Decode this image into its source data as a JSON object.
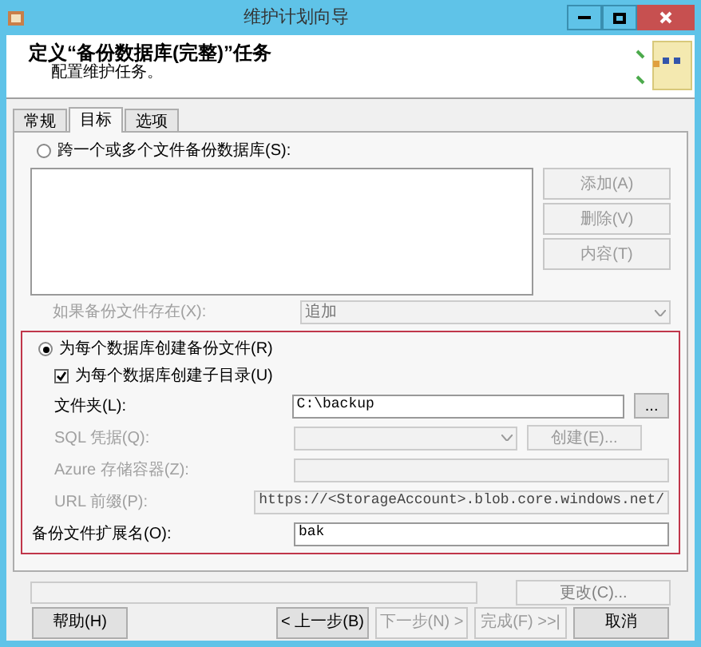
{
  "window": {
    "title": "维护计划向导"
  },
  "header": {
    "title": "定义“备份数据库(完整)”任务",
    "subtitle": "配置维护任务。"
  },
  "tabs": [
    {
      "label": "常规",
      "selected": false
    },
    {
      "label": "目标",
      "selected": true
    },
    {
      "label": "选项",
      "selected": false
    }
  ],
  "span_files": {
    "label": "跨一个或多个文件备份数据库(S):",
    "selected": false,
    "buttons": [
      {
        "label": "添加(A)",
        "disabled": true
      },
      {
        "label": "删除(V)",
        "disabled": true
      },
      {
        "label": "内容(T)",
        "disabled": true
      }
    ]
  },
  "if_exists": {
    "label": "如果备份文件存在(X):",
    "value": "追加",
    "disabled": true
  },
  "per_database": {
    "label": "为每个数据库创建备份文件(R)",
    "selected": true
  },
  "subdirectory": {
    "label": "为每个数据库创建子目录(U)",
    "checked": true
  },
  "fields": [
    {
      "kind": "text",
      "label": "文件夹(L):",
      "value": "C:\\backup",
      "disabled": false,
      "button": "..."
    },
    {
      "kind": "select",
      "label": "SQL 凭据(Q):",
      "disabled": true,
      "button": "创建(E)..."
    },
    {
      "kind": "text",
      "label": "Azure 存储容器(Z):",
      "disabled": true
    },
    {
      "kind": "text",
      "label": "URL 前缀(P):",
      "value": "https://<StorageAccount>.blob.core.windows.net/",
      "disabled": true
    }
  ],
  "extension": {
    "label": "备份文件扩展名(O):",
    "value": "bak"
  },
  "schedule": {
    "button": "更改(C)..."
  },
  "footer": [
    {
      "label": "帮助(H)",
      "disabled": false
    },
    {
      "label": "< 上一步(B)",
      "disabled": false
    },
    {
      "label": "下一步(N) >",
      "disabled": true
    },
    {
      "label": "完成(F) >>|",
      "disabled": true
    },
    {
      "label": "取消",
      "disabled": false
    }
  ]
}
